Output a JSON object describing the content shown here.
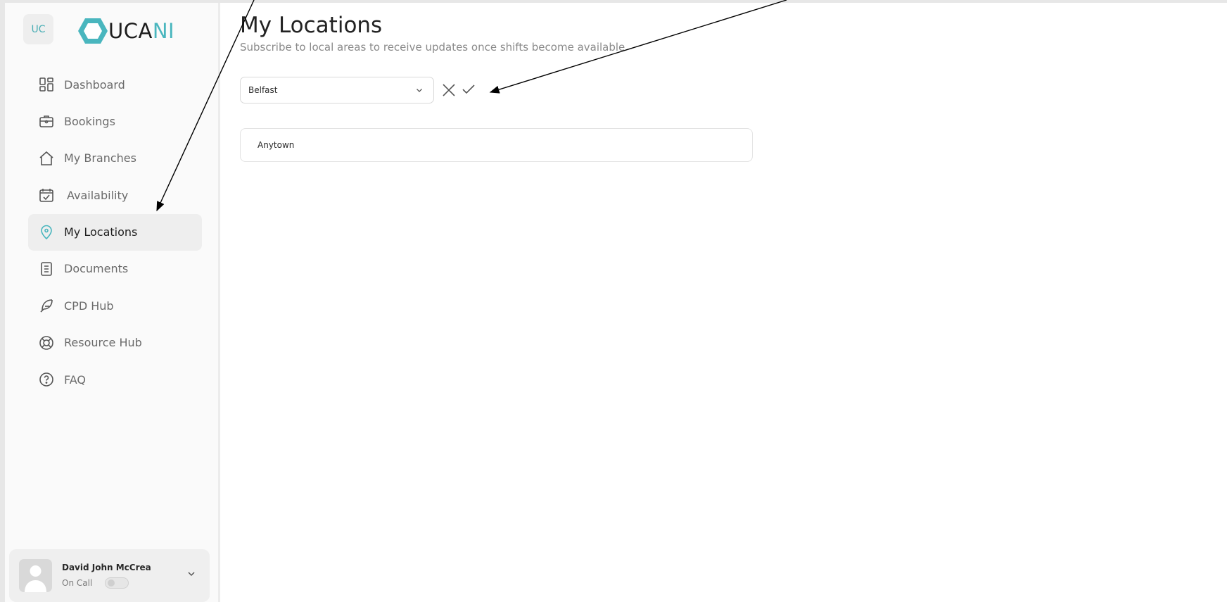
{
  "brand": {
    "badge": "UC",
    "logo_text_main": "UCA",
    "logo_text_accent": "NI",
    "accent_color": "#49b6be"
  },
  "sidebar": {
    "items": [
      {
        "label": "Dashboard",
        "icon": "dashboard-icon"
      },
      {
        "label": "Bookings",
        "icon": "briefcase-icon"
      },
      {
        "label": "My Branches",
        "icon": "home-icon"
      },
      {
        "label": "Availability",
        "icon": "calendar-check-icon"
      },
      {
        "label": "My Locations",
        "icon": "location-pin-icon",
        "active": true
      },
      {
        "label": "Documents",
        "icon": "document-icon"
      },
      {
        "label": "CPD Hub",
        "icon": "feather-icon"
      },
      {
        "label": "Resource Hub",
        "icon": "lifebuoy-icon"
      },
      {
        "label": "FAQ",
        "icon": "question-icon"
      }
    ]
  },
  "user": {
    "name": "David John McCrea",
    "status_label": "On Call",
    "on_call": false
  },
  "main": {
    "title": "My Locations",
    "subtitle": "Subscribe to local areas to receive updates once shifts become available",
    "location_select": {
      "value": "Belfast"
    },
    "subscribed_locations": [
      "Anytown"
    ]
  }
}
